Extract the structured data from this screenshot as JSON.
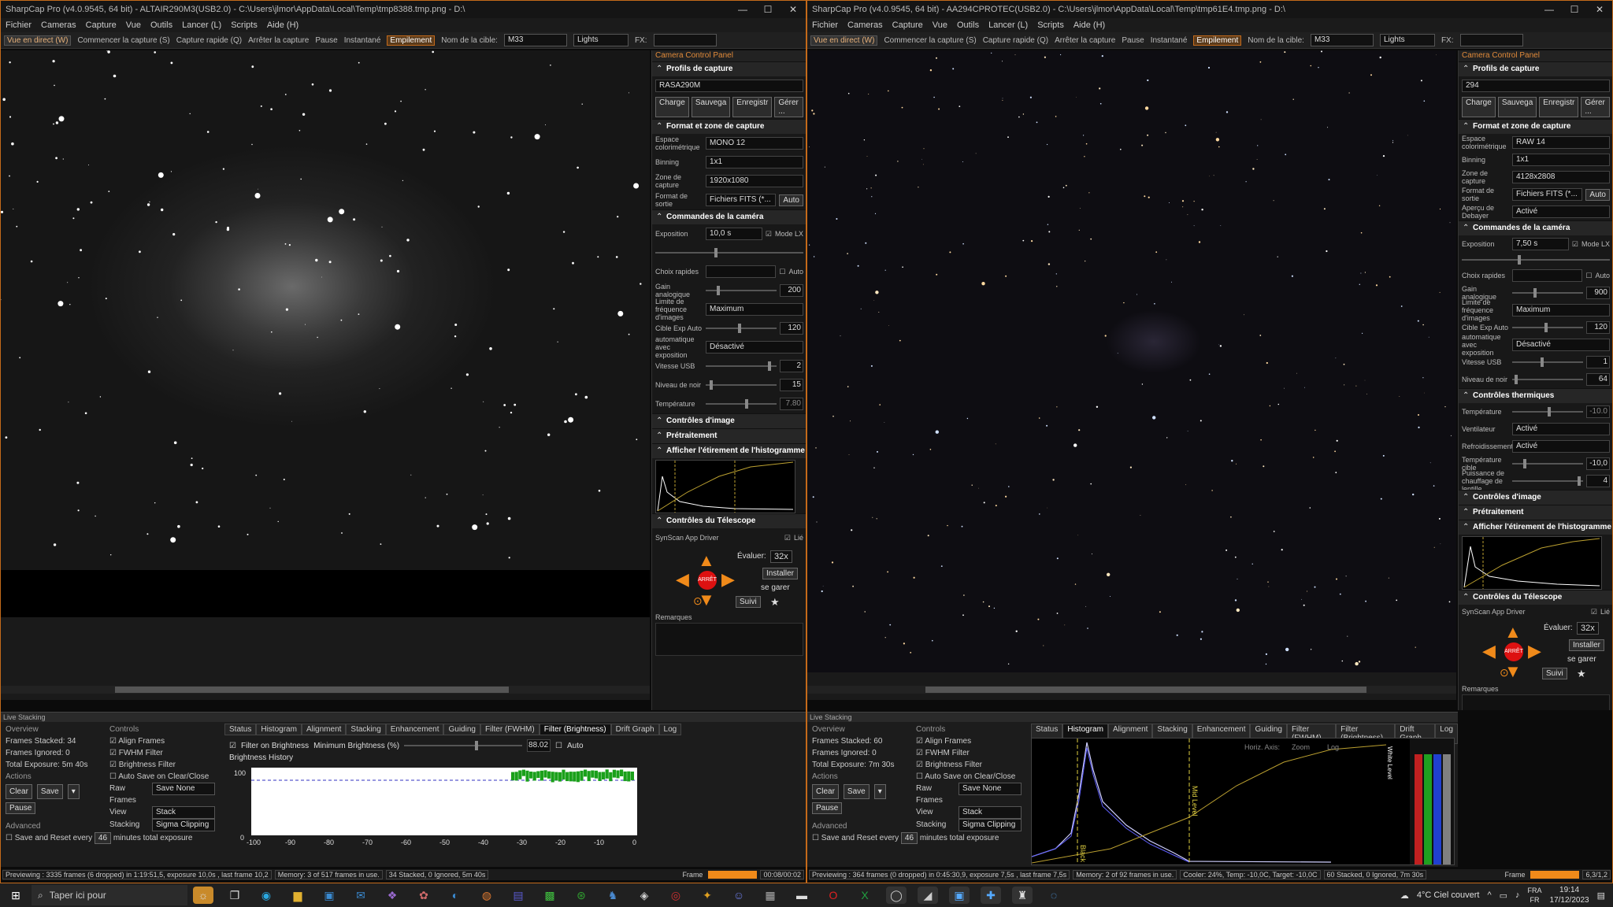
{
  "left": {
    "title": "SharpCap Pro (v4.0.9545, 64 bit) - ALTAIR290M3(USB2.0) - C:\\Users\\jlmor\\AppData\\Local\\Temp\\tmp8388.tmp.png - D:\\",
    "menu": [
      "Fichier",
      "Cameras",
      "Capture",
      "Vue",
      "Outils",
      "Lancer (L)",
      "Scripts",
      "Aide (H)"
    ],
    "toolbar": {
      "live": "Vue en direct (W)",
      "start": "Commencer la capture (S)",
      "quick": "Capture rapide (Q)",
      "stop": "Arrêter la capture",
      "pause": "Pause",
      "snap": "Instantané",
      "stack": "Empilement",
      "target_label": "Nom de la cible:",
      "target": "M33",
      "frame_type": "Lights",
      "fx": "FX:"
    },
    "ccp": {
      "header": "Camera Control Panel",
      "profiles": "Profils de capture",
      "profile": "RASA290M",
      "btns": [
        "Charge",
        "Sauvega",
        "Enregistr",
        "Gérer ..."
      ],
      "format_sec": "Format et zone de capture",
      "rows": [
        [
          "Espace colorimétrique",
          "MONO 12"
        ],
        [
          "Binning",
          "1x1"
        ],
        [
          "Zone de capture",
          "1920x1080"
        ],
        [
          "Format de sortie",
          "Fichiers FITS (*..."
        ]
      ],
      "auto": "Auto",
      "cam_sec": "Commandes de la caméra",
      "exposure_label": "Exposition",
      "exposure": "10,0 s",
      "mode_lx": "Mode LX",
      "choix": "Choix rapides",
      "auto2": "Auto",
      "gain_label": "Gain analogique",
      "gain": "200",
      "fps_label": "Limite de fréquence d'images",
      "fps": "Maximum",
      "cible_label": "Cible Exp Auto",
      "cible": "120",
      "autoexp_label": "automatique avec exposition",
      "autoexp": "Désactivé",
      "usb_label": "Vitesse USB",
      "usb": "2",
      "noir_label": "Niveau de noir",
      "noir": "15",
      "temp_label": "Température",
      "temp": "7.80",
      "img_sec": "Contrôles d'image",
      "pre_sec": "Prétraitement",
      "histo_sec": "Afficher l'étirement de l'histogramme",
      "tel_sec": "Contrôles du Télescope",
      "driver": "SynScan App Driver",
      "lie": "Lié",
      "eval": "Évaluer:",
      "eval_val": "32x",
      "install": "Installer",
      "garer": "se garer",
      "suivi": "Suivi",
      "stop": "ARRÊT",
      "remarques": "Remarques"
    },
    "ls": {
      "title": "Live Stacking",
      "overview": "Overview",
      "stacked": "Frames Stacked: 34",
      "ignored": "Frames Ignored: 0",
      "total": "Total Exposure:   5m 40s",
      "actions": "Actions",
      "clear": "Clear",
      "save": "Save",
      "pause": "Pause",
      "controls": "Controls",
      "align": "Align Frames",
      "fwhm": "FWHM Filter",
      "bright": "Brightness Filter",
      "autosave": "Auto Save on Clear/Close",
      "raw_label": "Raw Frames",
      "raw": "Save None",
      "view_label": "View",
      "view": "Stack",
      "stacking_label": "Stacking",
      "stacking": "Sigma Clipping",
      "advanced": "Advanced",
      "reset": "Save and Reset every",
      "reset_val": "46",
      "minutes": "minutes total exposure",
      "tabs": [
        "Status",
        "Histogram",
        "Alignment",
        "Stacking",
        "Enhancement",
        "Guiding",
        "Filter (FWHM)",
        "Filter (Brightness)",
        "Drift Graph",
        "Log"
      ],
      "filter_on": "Filter on Brightness",
      "min_bright": "Minimum Brightness (%)",
      "min_val": "88.02",
      "auto": "Auto",
      "history": "Brightness History",
      "y100": "100",
      "y0": "0",
      "xticks": [
        "-100",
        "-90",
        "-80",
        "-70",
        "-60",
        "-50",
        "-40",
        "-30",
        "-20",
        "-10",
        "0"
      ]
    },
    "status": [
      "Previewing : 3335 frames (6 dropped) in 1:19:51,5, exposure 10,0s , last frame 10,2",
      "Memory: 3 of 517 frames in use.",
      "34 Stacked, 0 Ignored, 5m 40s"
    ],
    "frame": "Frame",
    "frame_time": "00:08/00:02"
  },
  "right": {
    "title": "SharpCap Pro (v4.0.9545, 64 bit) - AA294CPROTEC(USB2.0) - C:\\Users\\jlmor\\AppData\\Local\\Temp\\tmp61E4.tmp.png - D:\\",
    "menu": [
      "Fichier",
      "Cameras",
      "Capture",
      "Vue",
      "Outils",
      "Lancer (L)",
      "Scripts",
      "Aide (H)"
    ],
    "toolbar": {
      "live": "Vue en direct (W)",
      "start": "Commencer la capture (S)",
      "quick": "Capture rapide (Q)",
      "stop": "Arrêter la capture",
      "pause": "Pause",
      "snap": "Instantané",
      "stack": "Empilement",
      "target_label": "Nom de la cible:",
      "target": "M33",
      "frame_type": "Lights",
      "fx": "FX:"
    },
    "ccp": {
      "header": "Camera Control Panel",
      "profiles": "Profils de capture",
      "profile": "294",
      "btns": [
        "Charge",
        "Sauvega",
        "Enregistr",
        "Gérer ..."
      ],
      "format_sec": "Format et zone de capture",
      "rows": [
        [
          "Espace colorimétrique",
          "RAW 14"
        ],
        [
          "Binning",
          "1x1"
        ],
        [
          "Zone de capture",
          "4128x2808"
        ],
        [
          "Format de sortie",
          "Fichiers FITS (*..."
        ],
        [
          "Aperçu de Debayer",
          "Activé"
        ]
      ],
      "auto": "Auto",
      "cam_sec": "Commandes de la caméra",
      "exposure_label": "Exposition",
      "exposure": "7,50 s",
      "mode_lx": "Mode LX",
      "choix": "Choix rapides",
      "auto2": "Auto",
      "gain_label": "Gain analogique",
      "gain": "900",
      "fps_label": "Limite de fréquence d'images",
      "fps": "Maximum",
      "cible_label": "Cible Exp Auto",
      "cible": "120",
      "autoexp_label": "automatique avec exposition",
      "autoexp": "Désactivé",
      "usb_label": "Vitesse USB",
      "usb": "1",
      "noir_label": "Niveau de noir",
      "noir": "64",
      "therm_sec": "Contrôles thermiques",
      "temp_label": "Température",
      "temp": "-10.0",
      "vent_label": "Ventilateur",
      "vent": "Activé",
      "refr_label": "Refroidissement",
      "refr": "Activé",
      "tc_label": "Température cible",
      "tc": "-10,0",
      "pc_label": "Puissance de chauffage de lentille",
      "pc": "4",
      "img_sec": "Contrôles d'image",
      "pre_sec": "Prétraitement",
      "histo_sec": "Afficher l'étirement de l'histogramme",
      "tel_sec": "Contrôles du Télescope",
      "driver": "SynScan App Driver",
      "lie": "Lié",
      "eval": "Évaluer:",
      "eval_val": "32x",
      "install": "Installer",
      "garer": "se garer",
      "suivi": "Suivi",
      "stop": "ARRÊT",
      "remarques": "Remarques"
    },
    "ls": {
      "title": "Live Stacking",
      "overview": "Overview",
      "stacked": "Frames Stacked: 60",
      "ignored": "Frames Ignored: 0",
      "total": "Total Exposure:   7m 30s",
      "actions": "Actions",
      "clear": "Clear",
      "save": "Save",
      "pause": "Pause",
      "controls": "Controls",
      "align": "Align Frames",
      "fwhm": "FWHM Filter",
      "bright": "Brightness Filter",
      "autosave": "Auto Save on Clear/Close",
      "raw_label": "Raw Frames",
      "raw": "Save None",
      "view_label": "View",
      "view": "Stack",
      "stacking_label": "Stacking",
      "stacking": "Sigma Clipping",
      "advanced": "Advanced",
      "reset": "Save and Reset every",
      "reset_val": "46",
      "minutes": "minutes total exposure",
      "tabs": [
        "Status",
        "Histogram",
        "Alignment",
        "Stacking",
        "Enhancement",
        "Guiding",
        "Filter (FWHM)",
        "Filter (Brightness)",
        "Drift Graph",
        "Log"
      ],
      "hist_axis": "Horiz. Axis:",
      "zoom": "Zoom",
      "log": "Log",
      "black": "Black Level",
      "mid": "Mid Level",
      "white": "White Level"
    },
    "status": [
      "Previewing : 364 frames (0 dropped) in 0:45:30,9, exposure 7,5s , last frame 7,5s",
      "Memory: 2 of 92 frames in use.",
      "Cooler: 24%, Temp: -10,0C, Target: -10,0C",
      "60 Stacked, 0 Ignored, 7m 30s"
    ],
    "frame": "Frame",
    "frame_time": "6,3/1,2"
  },
  "taskbar": {
    "search": "Taper ici pour",
    "weather": "4°C  Ciel couvert",
    "lang1": "FRA",
    "lang2": "FR",
    "time": "19:14",
    "date": "17/12/2023"
  }
}
